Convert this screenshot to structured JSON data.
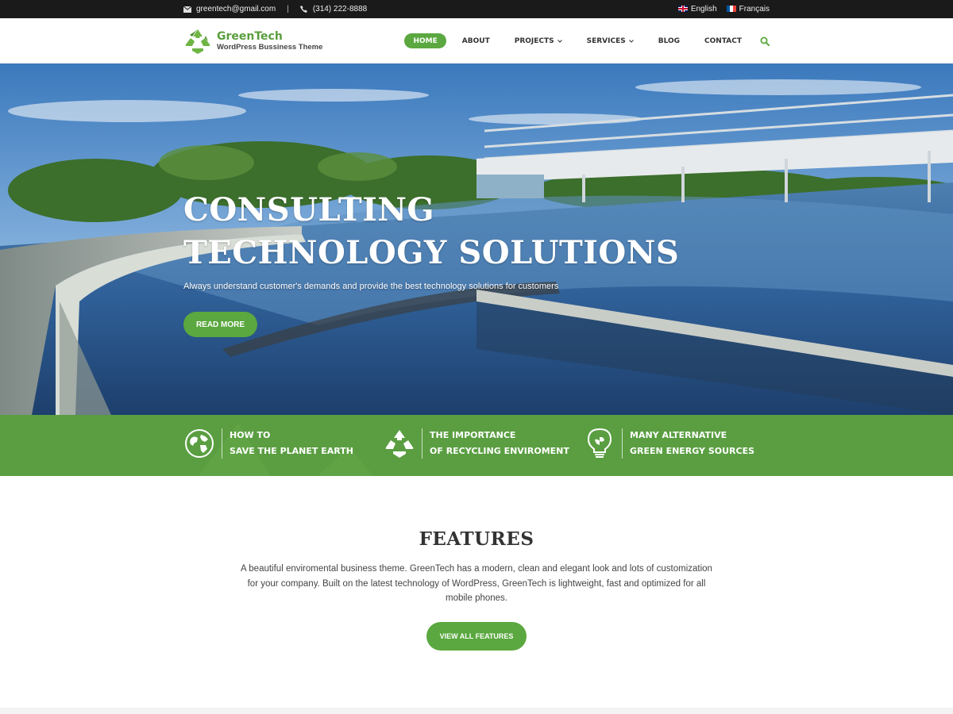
{
  "topbar": {
    "email": "greentech@gmail.com",
    "phone": "(314) 222-8888",
    "lang_en": "English",
    "lang_fr": "Français"
  },
  "header": {
    "brand": "GreenTech",
    "tagline": "WordPress Bussiness Theme",
    "nav": [
      "HOME",
      "ABOUT",
      "PROJECTS",
      "SERVICES",
      "BLOG",
      "CONTACT"
    ],
    "active": "HOME"
  },
  "hero": {
    "title_line1": "CONSULTING",
    "title_line2": "TECHNOLOGY SOLUTIONS",
    "subtitle": "Always understand customer's demands and provide the best technology solutions for customers",
    "button": "READ MORE"
  },
  "strip": {
    "items": [
      {
        "line1": "HOW TO",
        "line2": "SAVE THE PLANET EARTH",
        "icon": "globe-icon"
      },
      {
        "line1": "THE IMPORTANCE",
        "line2": "OF RECYCLING ENVIROMENT",
        "icon": "recycle-icon"
      },
      {
        "line1": "MANY ALTERNATIVE",
        "line2": "GREEN ENERGY SOURCES",
        "icon": "bulb-icon"
      }
    ]
  },
  "features": {
    "title": "FEATURES",
    "description": "A beautiful enviromental business theme. GreenTech has a modern, clean and elegant look and lots of customization for your company. Built on the latest technology of WordPress, GreenTech is lightweight, fast and optimized for all mobile phones.",
    "button": "VIEW ALL FEATURES"
  },
  "colors": {
    "brand_green": "#5aa83f",
    "strip_green": "#5a9e41",
    "topbar_dark": "#1a1a1a"
  }
}
